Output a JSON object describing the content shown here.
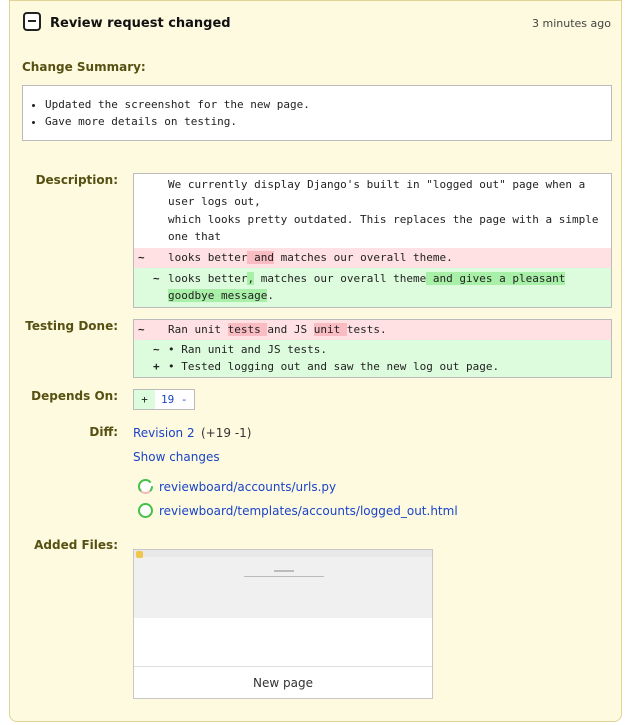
{
  "header": {
    "title": "Review request changed",
    "timestamp": "3 minutes ago"
  },
  "change_summary": {
    "label": "Change Summary:",
    "items": [
      "Updated the screenshot for the new page.",
      "Gave more details on testing."
    ]
  },
  "description": {
    "label": "Description:",
    "line1": "We currently display Django's built in \"logged out\" page when a user logs out,",
    "line2": "which looks pretty outdated. This replaces the page with a simple one that",
    "removed": {
      "mark": "~",
      "a": "looks better",
      "b": " and",
      "c": " matches our overall theme."
    },
    "inserted": {
      "mark": "~",
      "a": "looks better",
      "b": ",",
      "c": " matches our overall theme",
      "d": " and gives a pleasant goodbye message",
      "e": "."
    }
  },
  "testing_done": {
    "label": "Testing Done:",
    "removed": {
      "mark": "~",
      "a": "Ran unit ",
      "b": "tests ",
      "c": "and JS ",
      "d": "unit ",
      "e": "tests."
    },
    "inserted1": {
      "mark": "~",
      "text": "Ran unit and JS tests."
    },
    "inserted2": {
      "mark": "+",
      "text": "Tested logging out and saw the new log out page."
    }
  },
  "depends_on": {
    "label": "Depends On:",
    "plus": "+",
    "item": "19",
    "remove": "-"
  },
  "diff": {
    "label": "Diff:",
    "revision": "Revision 2",
    "counts": "(+19 -1)",
    "show_changes": "Show changes",
    "files": [
      "reviewboard/accounts/urls.py",
      "reviewboard/templates/accounts/logged_out.html"
    ]
  },
  "added_files": {
    "label": "Added Files:",
    "caption": "New page"
  }
}
